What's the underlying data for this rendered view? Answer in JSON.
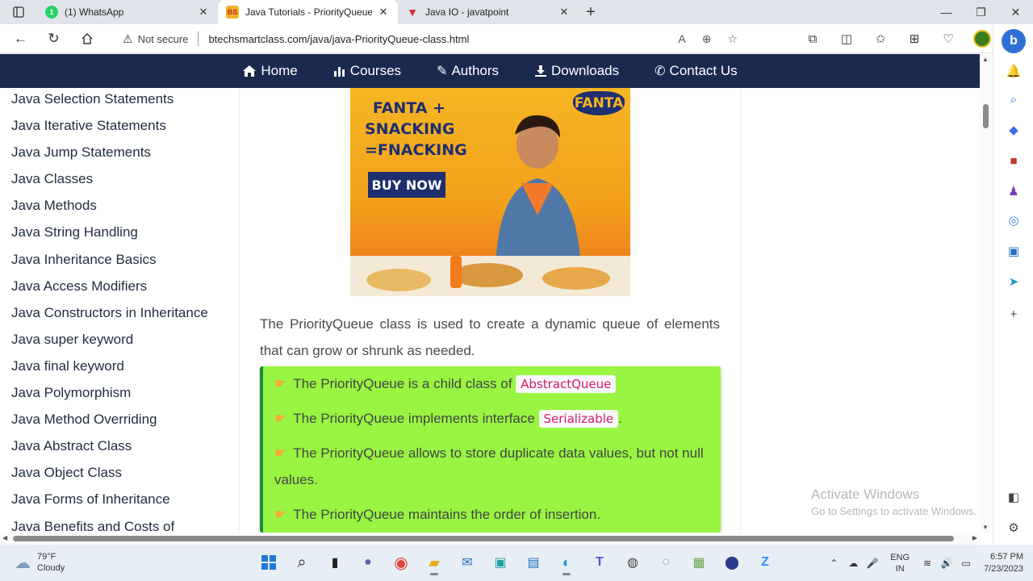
{
  "tabs": [
    {
      "title": "(1) WhatsApp",
      "active": false,
      "favicon_color": "#25d366",
      "favicon_text": "1"
    },
    {
      "title": "Java Tutorials - PriorityQueue Cl",
      "active": true,
      "favicon_color": "#f0b323",
      "favicon_text": "BS"
    },
    {
      "title": "Java IO - javatpoint",
      "active": false,
      "favicon_color": "#e02a3c",
      "favicon_text": "▼"
    }
  ],
  "address_bar": {
    "security": "Not secure",
    "url": "btechsmartclass.com/java/java-PriorityQueue-class.html"
  },
  "navbar": [
    {
      "label": "Home",
      "icon": "home-icon"
    },
    {
      "label": "Courses",
      "icon": "bar-chart-icon"
    },
    {
      "label": "Authors",
      "icon": "pencil-icon"
    },
    {
      "label": "Downloads",
      "icon": "download-icon"
    },
    {
      "label": "Contact Us",
      "icon": "phone-icon"
    }
  ],
  "sidebar": {
    "items": [
      "Java Selection Statements",
      "Java Iterative Statements",
      "Java Jump Statements",
      "Java Classes",
      "Java Methods",
      "Java String Handling",
      "Java Inheritance Basics",
      "Java Access Modifiers",
      "Java Constructors in Inheritance",
      "Java super keyword",
      "Java final keyword",
      "Java Polymorphism",
      "Java Method Overriding",
      "Java Abstract Class",
      "Java Object Class",
      "Java Forms of Inheritance",
      "Java Benefits and Costs of"
    ]
  },
  "ad": {
    "line1": "FANTA +",
    "line2": "SNACKING",
    "line3": "=FNACKING",
    "button": "BUY NOW",
    "brand": "FANTA"
  },
  "content": {
    "intro": "The PriorityQueue class is used to create a dynamic queue of elements that can grow or shrunk as needed.",
    "points": [
      {
        "text": "The PriorityQueue is a child class of",
        "code": "AbstractQueue",
        "after": ""
      },
      {
        "text": "The PriorityQueue implements interface",
        "code": "Serializable",
        "after": "."
      },
      {
        "text": "The PriorityQueue allows to store duplicate data values, but not null",
        "cont": "values."
      },
      {
        "text": "The PriorityQueue maintains the order of insertion."
      }
    ]
  },
  "watermark": {
    "title": "Activate Windows",
    "subtitle": "Go to Settings to activate Windows."
  },
  "taskbar": {
    "weather_temp": "79°F",
    "weather_desc": "Cloudy",
    "lang_1": "ENG",
    "lang_2": "IN",
    "time": "6:57 PM",
    "date": "7/23/2023"
  }
}
